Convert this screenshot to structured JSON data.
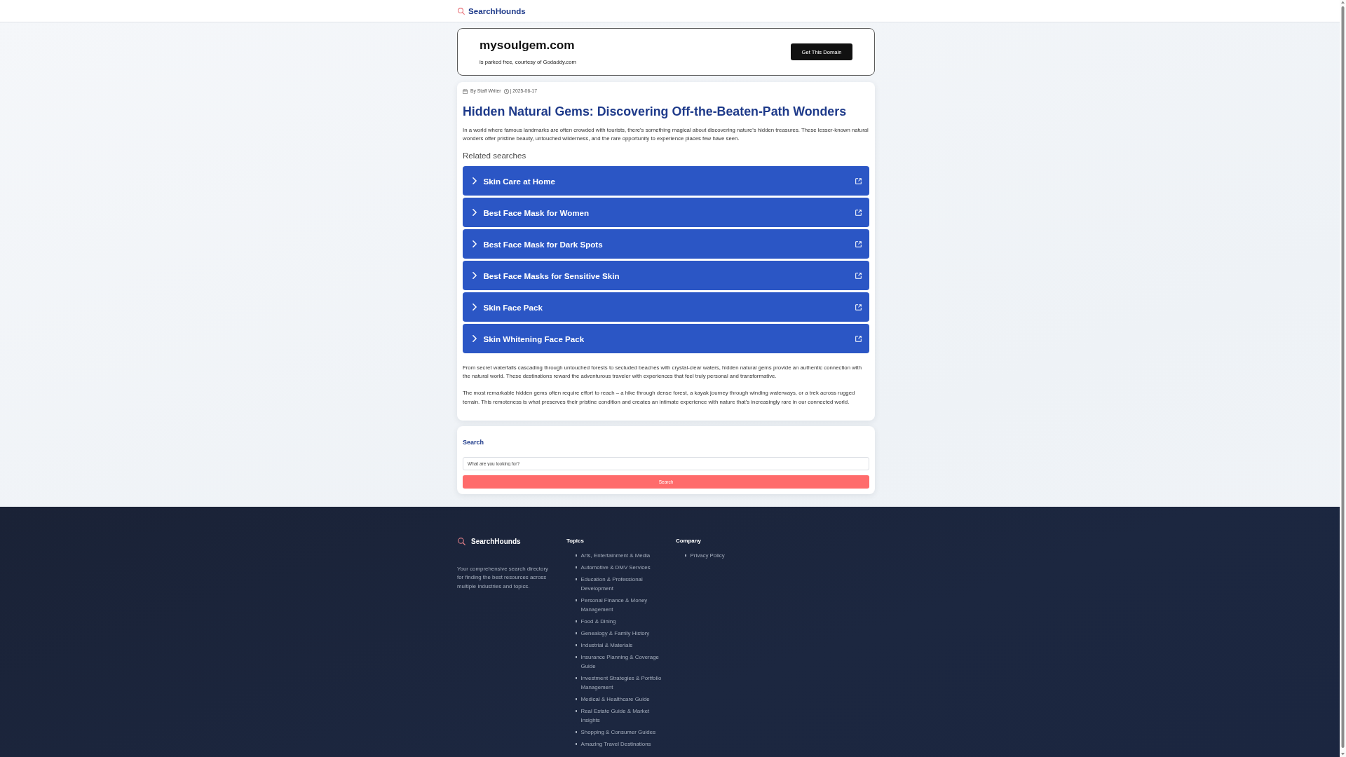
{
  "nav": {
    "brand": "SearchHounds"
  },
  "domain_banner": {
    "domain": "mysoulgem.com",
    "note": "is parked free, courtesy of Godaddy.com",
    "button": "Get This Domain"
  },
  "article": {
    "author": "By Staff Writer",
    "date": "| 2025-06-17",
    "title": "Hidden Natural Gems: Discovering Off-the-Beaten-Path Wonders",
    "intro": "In a world where famous landmarks are often crowded with tourists, there's something magical about discovering nature's hidden treasures. These lesser-known natural wonders offer pristine beauty, untouched wilderness, and the rare opportunity to experience places few have seen.",
    "related_heading": "Related searches",
    "related_searches": [
      "Skin Care at Home",
      "Best Face Mask for Women",
      "Best Face Mask for Dark Spots",
      "Best Face Masks for Sensitive Skin",
      "Skin Face Pack",
      "Skin Whitening Face Pack"
    ],
    "paragraphs": [
      "From secret waterfalls cascading through untouched forests to secluded beaches with crystal-clear waters, hidden natural gems provide an authentic connection with the natural world. These destinations reward the adventurous traveler with experiences that feel truly personal and transformative.",
      "The most remarkable hidden gems often require effort to reach – a hike through dense forest, a kayak journey through winding waterways, or a trek across rugged terrain. This remoteness is what preserves their pristine condition and creates an intimate experience with nature that's increasingly rare in our connected world."
    ]
  },
  "search": {
    "heading": "Search",
    "placeholder": "What are you looking for?",
    "button": "Search"
  },
  "footer": {
    "brand": "SearchHounds",
    "description": "Your comprehensive search directory for finding the best resources across multiple industries and topics.",
    "columns": [
      {
        "heading": "Topics",
        "links": [
          "Arts, Entertainment & Media",
          "Automotive & DMV Services",
          "Education & Professional Development",
          "Personal Finance & Money Management",
          "Food & Dining",
          "Genealogy & Family History",
          "Industrial & Materials",
          "Insurance Planning & Coverage Guide",
          "Investment Strategies & Portfolio Management",
          "Medical & Healthcare Guide",
          "Real Estate Guide & Market Insights",
          "Shopping & Consumer Guides",
          "Amazing Travel Destinations"
        ]
      },
      {
        "heading": "Company",
        "links": [
          "Privacy Policy"
        ]
      }
    ]
  }
}
